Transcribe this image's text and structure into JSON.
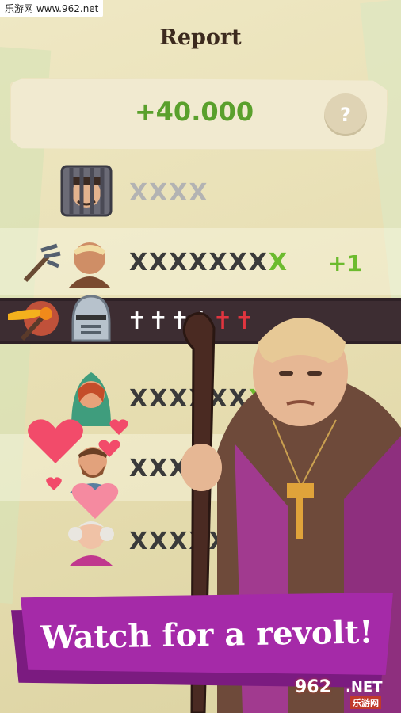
{
  "watermark_top": "乐游网 www.962.net",
  "report": {
    "title": "Report",
    "money": "+40.000",
    "help_label": "?"
  },
  "rows": [
    {
      "character": "prisoner-in-cage",
      "marks": [
        {
          "text": "XXXX",
          "color": "grey"
        }
      ],
      "bonus": ""
    },
    {
      "character": "peasant-with-pitchfork",
      "marks": [
        {
          "text": "XXXXXXX",
          "color": "dark"
        },
        {
          "text": "X",
          "color": "green"
        }
      ],
      "bonus": "+1"
    },
    {
      "character": "knight-with-torch",
      "marks": [
        {
          "text": "✝✝✝✝",
          "color": "white"
        },
        {
          "text": "✝✝",
          "color": "red"
        }
      ],
      "bonus": ""
    },
    {
      "character": "noblewoman",
      "marks": [
        {
          "text": "XXXXXX",
          "color": "dark"
        },
        {
          "text": "X",
          "color": "green"
        }
      ],
      "bonus": ""
    },
    {
      "character": "bearded-man",
      "marks": [
        {
          "text": "XXXX",
          "color": "dark"
        }
      ],
      "bonus": ""
    },
    {
      "character": "powdered-wig-aristocrat",
      "marks": [
        {
          "text": "XXXXX",
          "color": "dark"
        },
        {
          "text": "X",
          "color": "red"
        }
      ],
      "bonus": ""
    }
  ],
  "banner": {
    "text": "Watch for a revolt!"
  },
  "watermark_bottom": {
    "brand": "962",
    "net": ".NET",
    "sub": "乐游网"
  },
  "colors": {
    "accent_purple": "#a52aa8",
    "money_green": "#5aa02c",
    "highlight_row": "#3d2d32"
  }
}
